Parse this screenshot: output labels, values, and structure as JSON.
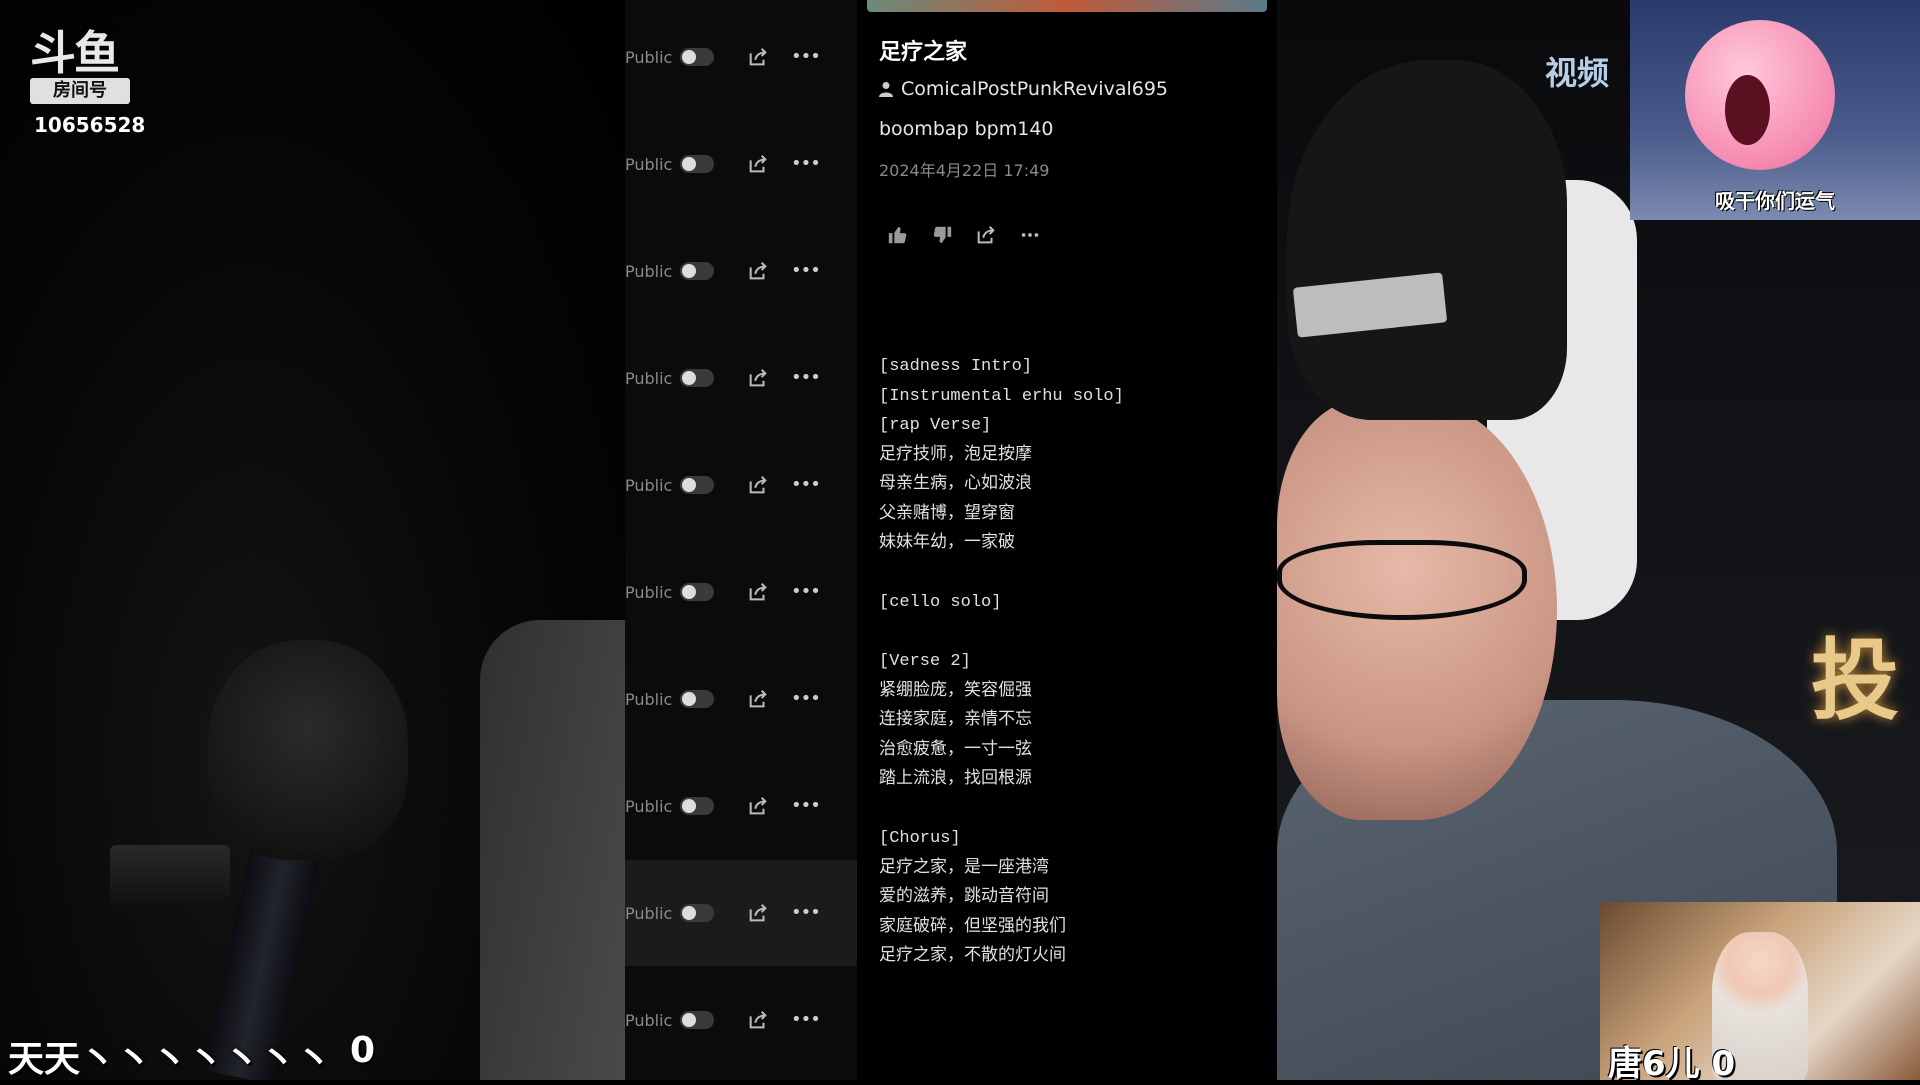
{
  "overlay": {
    "platform_logo": "斗鱼",
    "room_badge": "房间号",
    "room_number": "10656528",
    "bottom_left_text": "天天丶丶丶丶丶丶丶",
    "bottom_left_score": "0",
    "top_right_partial_text": "视频",
    "right_partial_glyph": "投",
    "sticker_caption": "吸干你们运气",
    "pip_label": "唐6儿",
    "pip_score": "0"
  },
  "song_list": {
    "rows": [
      {
        "visibility": "Public",
        "toggle_on": false
      },
      {
        "visibility": "Public",
        "toggle_on": false
      },
      {
        "visibility": "Public",
        "toggle_on": false
      },
      {
        "visibility": "Public",
        "toggle_on": false
      },
      {
        "visibility": "Public",
        "toggle_on": false
      },
      {
        "visibility": "Public",
        "toggle_on": false
      },
      {
        "visibility": "Public",
        "toggle_on": false
      },
      {
        "visibility": "Public",
        "toggle_on": false
      },
      {
        "visibility": "Public",
        "toggle_on": false
      },
      {
        "visibility": "Public",
        "toggle_on": false
      }
    ],
    "more_glyph": "•••"
  },
  "song": {
    "title": "足疗之家",
    "author": "ComicalPostPunkRevival695",
    "tags": "boombap bpm140",
    "date": "2024年4月22日 17:49",
    "lyrics": "[sadness Intro]\n[Instrumental erhu solo]\n[rap Verse]\n足疗技师，泡足按摩\n母亲生病，心如波浪\n父亲赌博，望穿窗\n妹妹年幼，一家破\n\n[cello solo]\n\n[Verse 2]\n紧绷脸庞，笑容倔强\n连接家庭，亲情不忘\n治愈疲惫，一寸一弦\n踏上流浪，找回根源\n\n[Chorus]\n足疗之家，是一座港湾\n爱的滋养，跳动音符间\n家庭破碎，但坚强的我们\n足疗之家，不散的灯火间"
  },
  "icons": {
    "row_share": "share-icon",
    "row_more": "more-icon",
    "author": "user-icon",
    "like": "thumbs-up-icon",
    "dislike": "thumbs-down-icon",
    "share": "share-icon",
    "more": "more-icon"
  }
}
